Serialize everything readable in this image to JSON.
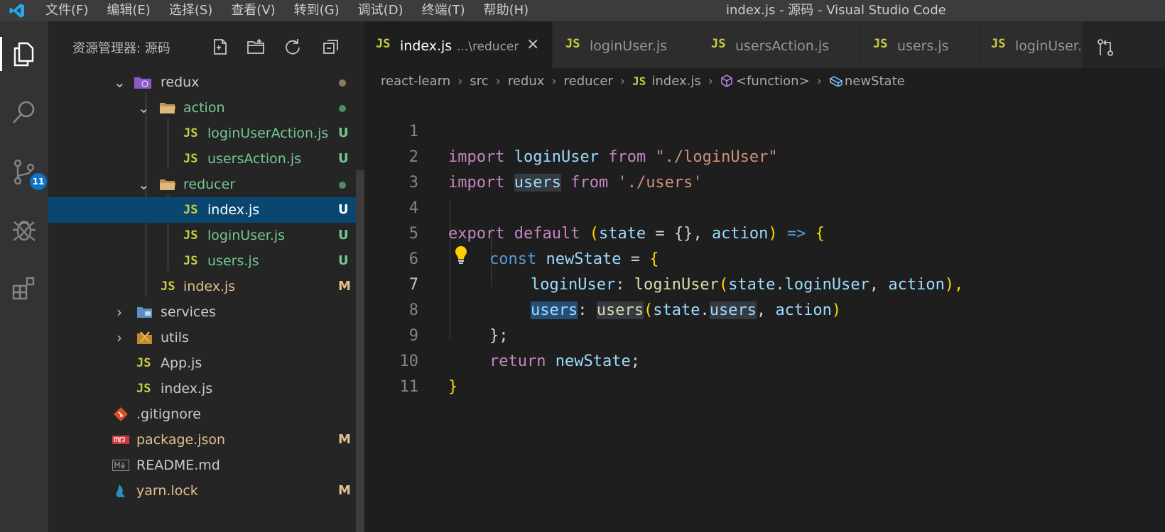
{
  "titlebar": {
    "logo": "vscode-logo-icon",
    "menu": [
      "文件(F)",
      "编辑(E)",
      "选择(S)",
      "查看(V)",
      "转到(G)",
      "调试(D)",
      "终端(T)",
      "帮助(H)"
    ],
    "window_title": "index.js - 源码 - Visual Studio Code"
  },
  "activity_bar": {
    "items": [
      "files-icon",
      "search-icon",
      "source-control-icon",
      "debug-icon",
      "extensions-icon"
    ],
    "source_control_badge": "11"
  },
  "sidebar": {
    "title": "资源管理器: 源码",
    "tools": [
      "new-file-icon",
      "new-folder-icon",
      "refresh-icon",
      "collapse-all-icon"
    ],
    "tree": [
      {
        "name": "redux",
        "type": "folder-open"
      },
      {
        "name": "action",
        "type": "folder-open"
      },
      {
        "name": "loginUserAction.js",
        "type": "js",
        "status": "U"
      },
      {
        "name": "usersAction.js",
        "type": "js",
        "status": "U"
      },
      {
        "name": "reducer",
        "type": "folder-open"
      },
      {
        "name": "index.js",
        "type": "js",
        "status": "U"
      },
      {
        "name": "loginUser.js",
        "type": "js",
        "status": "U"
      },
      {
        "name": "users.js",
        "type": "js",
        "status": "U"
      },
      {
        "name": "index.js",
        "type": "js",
        "status": "M"
      },
      {
        "name": "services",
        "type": "folder"
      },
      {
        "name": "utils",
        "type": "folder"
      },
      {
        "name": "App.js",
        "type": "js"
      },
      {
        "name": "index.js",
        "type": "js"
      },
      {
        "name": ".gitignore",
        "type": "git"
      },
      {
        "name": "package.json",
        "type": "npm",
        "status": "M"
      },
      {
        "name": "README.md",
        "type": "markdown"
      },
      {
        "name": "yarn.lock",
        "type": "yarn",
        "status": "M"
      }
    ]
  },
  "tabs": [
    {
      "icon": "JS",
      "name": "index.js",
      "description": "...\\reducer",
      "close": "×",
      "active": true
    },
    {
      "icon": "JS",
      "name": "loginUser.js"
    },
    {
      "icon": "JS",
      "name": "usersAction.js"
    },
    {
      "icon": "JS",
      "name": "users.js"
    },
    {
      "icon": "JS",
      "name": "loginUser."
    }
  ],
  "breadcrumb": [
    "react-learn",
    "src",
    "redux",
    "reducer",
    "index.js",
    "<function>",
    "newState"
  ],
  "breadcrumb_js": "JS",
  "line_numbers": [
    "1",
    "2",
    "3",
    "4",
    "5",
    "6",
    "7",
    "8",
    "9",
    "10",
    "11"
  ],
  "current_line": "7",
  "code": {
    "l1": [
      "import",
      "loginUser",
      "from",
      "\"./loginUser\""
    ],
    "l2": [
      "import",
      "users",
      "from",
      "'./users'"
    ],
    "l4": [
      "export",
      "default",
      "(",
      "state",
      " = ",
      "{}",
      ", ",
      "action",
      ") ",
      "=>",
      " ",
      "{"
    ],
    "l5": [
      "const",
      "newState",
      " = ",
      "{"
    ],
    "l6": [
      "loginUser",
      ": ",
      "loginUser",
      "(",
      "state",
      ".",
      "loginUser",
      ", ",
      "action",
      "),"
    ],
    "l7": [
      "users",
      ": ",
      "users",
      "(",
      "state",
      ".",
      "users",
      ", ",
      "action",
      ")"
    ],
    "l8": "};",
    "l9": [
      "return",
      "newState",
      ";"
    ],
    "l10": "}"
  },
  "colors": {
    "accent": "#0e72c7",
    "selection": "#094771",
    "untracked": "#73c991",
    "modified": "#e2c08d"
  }
}
